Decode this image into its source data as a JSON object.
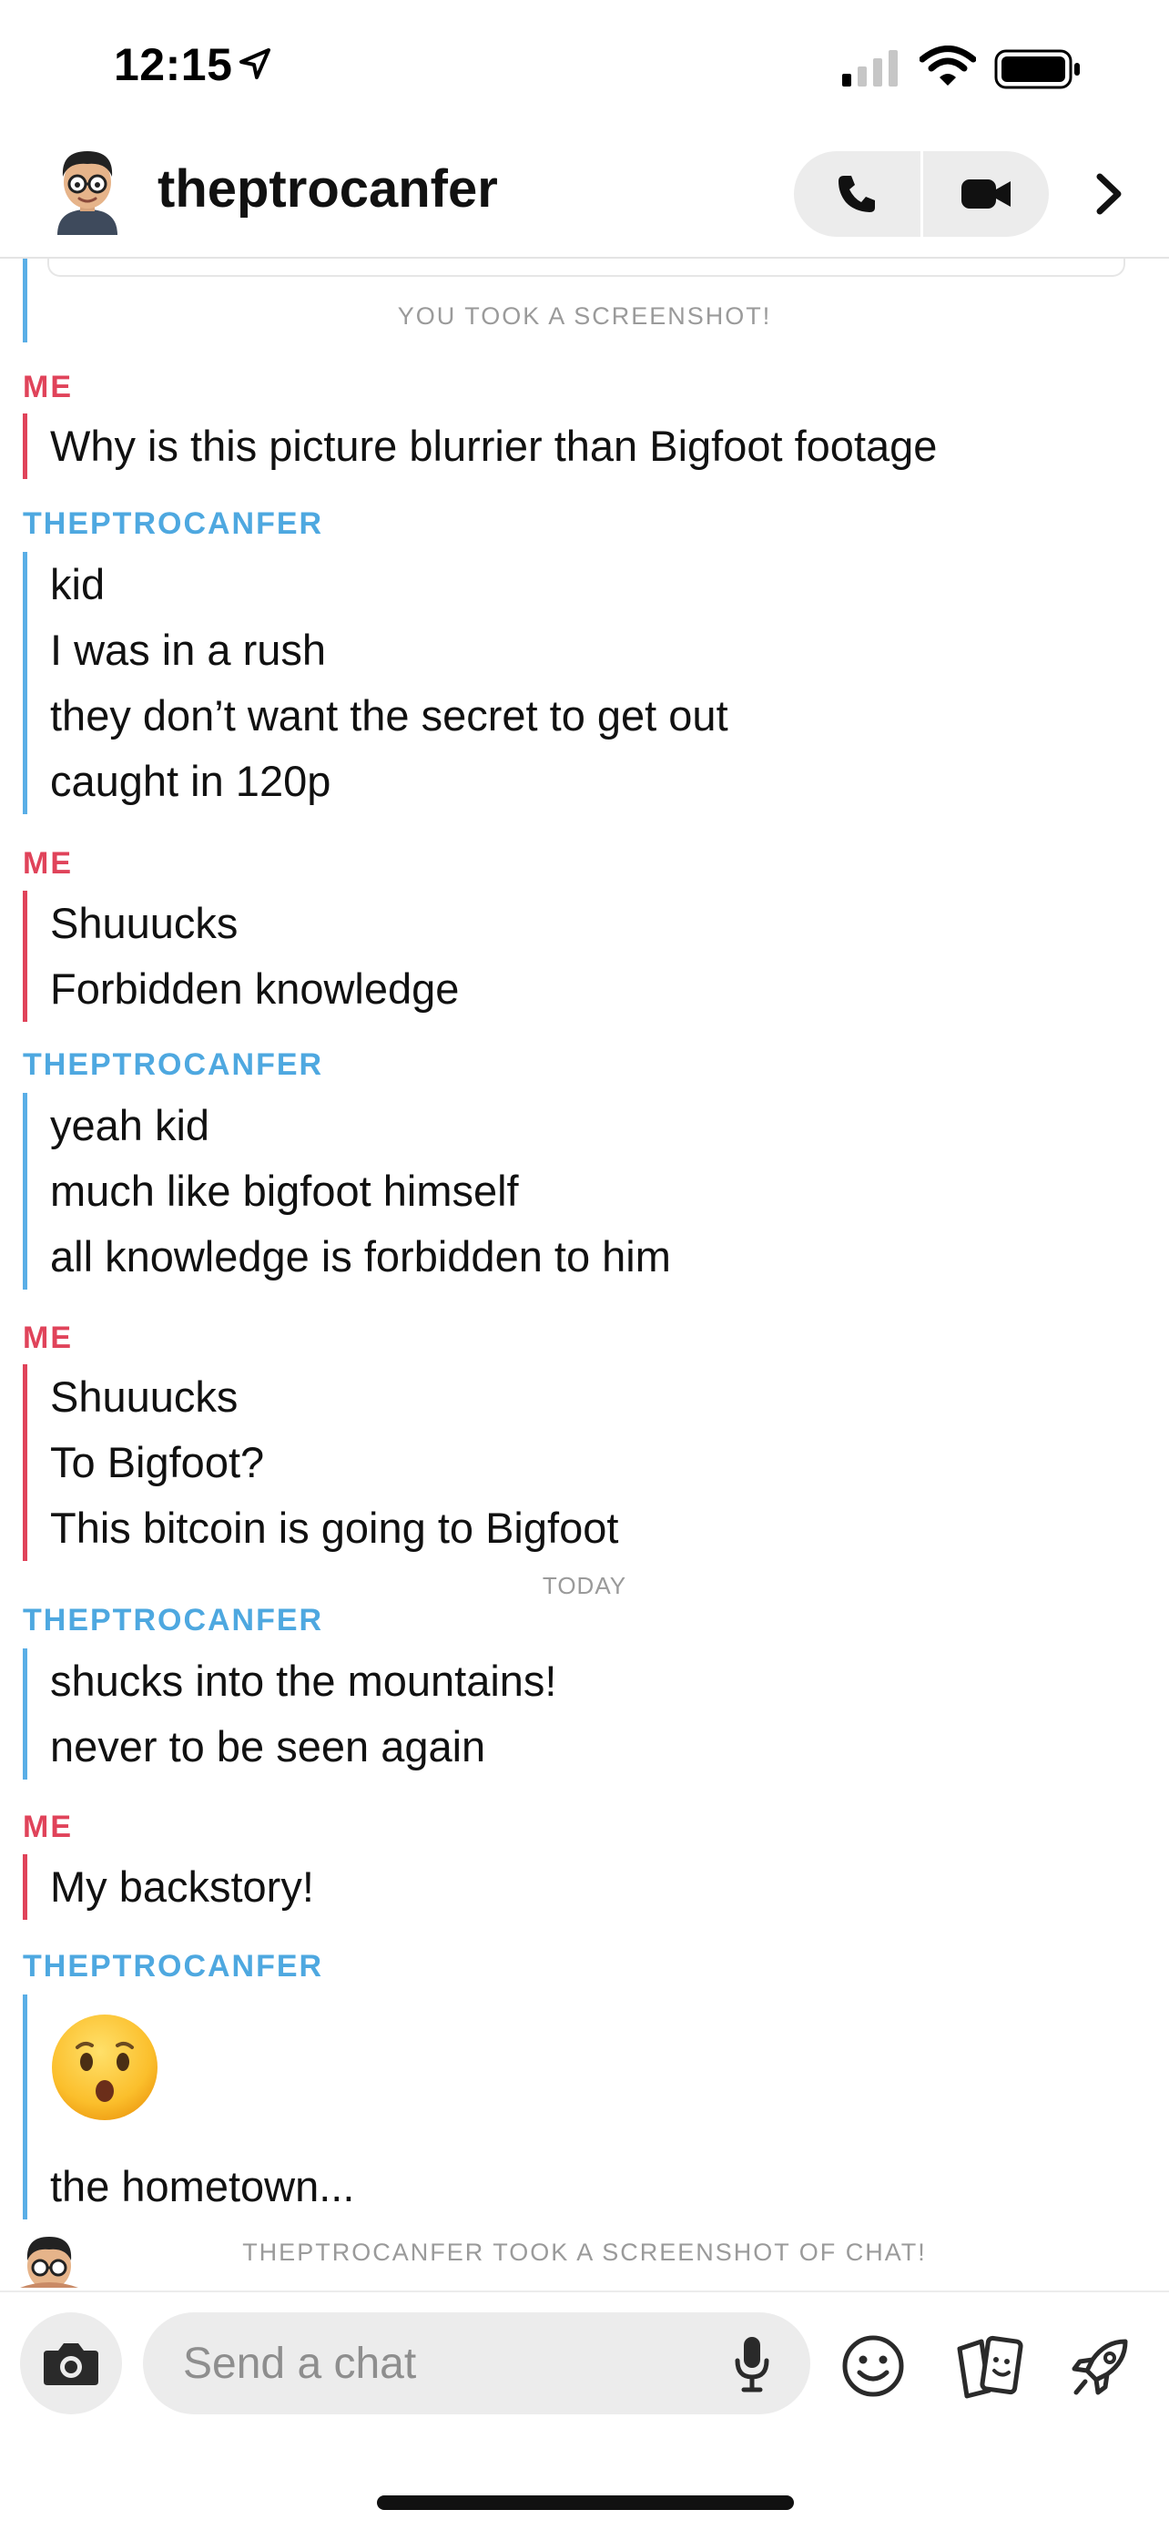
{
  "status_bar": {
    "time": "12:15",
    "icons": [
      "location-arrow-icon",
      "cellular-signal-icon",
      "wifi-icon",
      "battery-icon"
    ]
  },
  "header": {
    "username": "theptrocanfer",
    "icons": [
      "bitmoji-avatar",
      "phone-icon",
      "video-camera-icon",
      "chevron-right-icon"
    ]
  },
  "chat": {
    "system_top": "YOU TOOK A SCREENSHOT!",
    "today_label": "TODAY",
    "system_bottom": "THEPTROCANFER TOOK A SCREENSHOT OF CHAT!",
    "groups": [
      {
        "sender": "ME",
        "lines": [
          "Why is this picture blurrier than Bigfoot footage"
        ]
      },
      {
        "sender": "THEPTROCANFER",
        "lines": [
          "kid",
          "I was in a rush",
          "they don’t want the secret to get out",
          "caught in 120p"
        ]
      },
      {
        "sender": "ME",
        "lines": [
          "Shuuucks",
          "Forbidden knowledge"
        ]
      },
      {
        "sender": "THEPTROCANFER",
        "lines": [
          "yeah kid",
          "much like bigfoot himself",
          "all knowledge is forbidden to him"
        ]
      },
      {
        "sender": "ME",
        "lines": [
          "Shuuucks",
          "To Bigfoot?",
          "This bitcoin is going to Bigfoot"
        ]
      },
      {
        "sender": "THEPTROCANFER",
        "lines": [
          "shucks into the mountains!",
          "never to be seen again"
        ]
      },
      {
        "sender": "ME",
        "lines": [
          "My backstory!"
        ]
      },
      {
        "sender": "THEPTROCANFER",
        "emoji": "hushed-face-emoji",
        "lines": [
          "the hometown..."
        ]
      }
    ]
  },
  "input_bar": {
    "placeholder": "Send a chat",
    "icons": [
      "camera-icon",
      "microphone-icon",
      "smiley-icon",
      "cards-icon",
      "rocket-icon"
    ]
  },
  "colors": {
    "me": "#e0435a",
    "them": "#4ea8e0",
    "system_text": "#9a9a9a",
    "input_bg": "#ececec"
  }
}
